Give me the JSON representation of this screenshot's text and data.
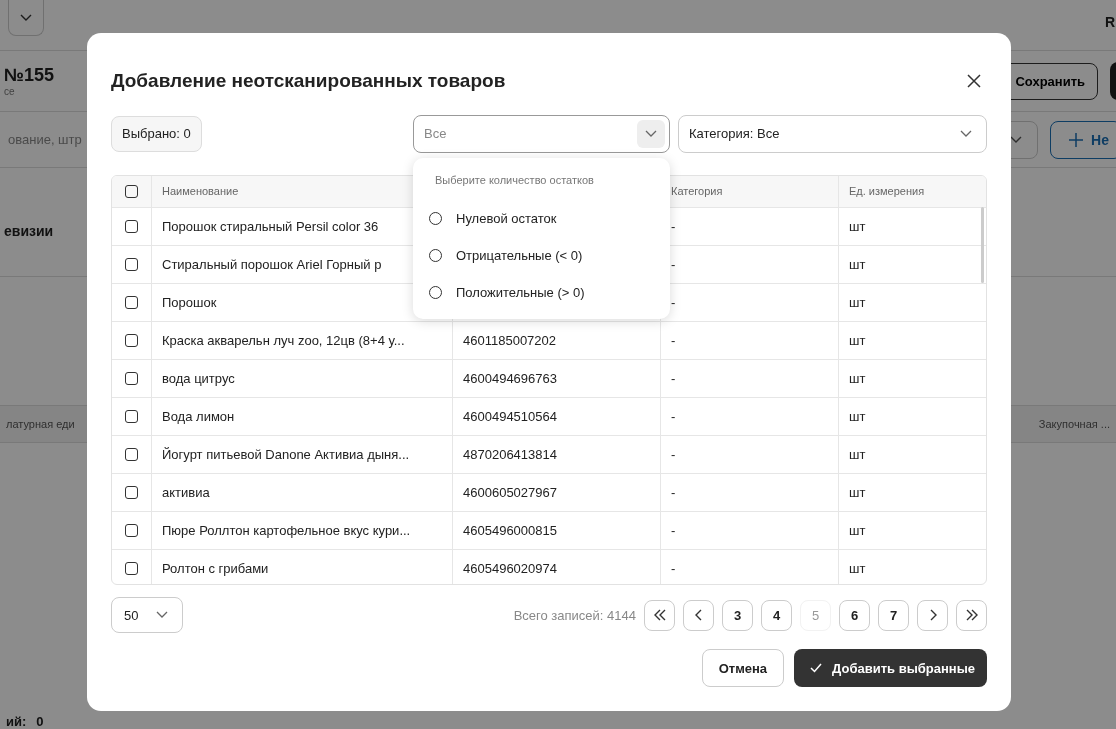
{
  "background": {
    "top_right_text": "R",
    "doc_title": "№155",
    "doc_subtitle": "се",
    "save_button": "Сохранить",
    "search_placeholder": "ование, штр",
    "add_button": "Не",
    "section_title": "евизии",
    "table_columns": [
      "латурная еди",
      "Закупочная ..."
    ],
    "footer_label": "ий:",
    "footer_value": "0"
  },
  "dialog": {
    "title": "Добавление неотсканированных товаров",
    "selected_count": "Выбрано: 0",
    "stock_filter": {
      "placeholder": "Все",
      "open": true,
      "menu_title": "Выберите количество остатков",
      "options": [
        {
          "label": "Нулевой остаток",
          "selected": false
        },
        {
          "label": "Отрицательные (< 0)",
          "selected": false
        },
        {
          "label": "Положительные (> 0)",
          "selected": false
        }
      ]
    },
    "category_filter": {
      "value": "Категория: Все"
    },
    "table": {
      "select_all_checked": false,
      "headers": {
        "name": "Наименование",
        "category": "Категория",
        "unit": "Ед. измерения"
      },
      "rows": [
        {
          "checked": false,
          "name": "Порошок стиральный Persil color 36",
          "barcode": null,
          "category": "-",
          "unit": "шт"
        },
        {
          "checked": false,
          "name": "Стиральный порошок Ariel Горный р",
          "barcode": null,
          "category": "-",
          "unit": "шт"
        },
        {
          "checked": false,
          "name": "Порошок",
          "barcode": null,
          "category": "-",
          "unit": "шт"
        },
        {
          "checked": false,
          "name": "Краска акварельн луч zoo, 12цв (8+4 у...",
          "barcode": "4601185007202",
          "category": "-",
          "unit": "шт"
        },
        {
          "checked": false,
          "name": "вода цитрус",
          "barcode": "4600494696763",
          "category": "-",
          "unit": "шт"
        },
        {
          "checked": false,
          "name": "Вода лимон",
          "barcode": "4600494510564",
          "category": "-",
          "unit": "шт"
        },
        {
          "checked": false,
          "name": "Йогурт питьевой Danone Активиа дыня...",
          "barcode": "4870206413814",
          "category": "-",
          "unit": "шт"
        },
        {
          "checked": false,
          "name": "активиа",
          "barcode": "4600605027967",
          "category": "-",
          "unit": "шт"
        },
        {
          "checked": false,
          "name": "Пюре Роллтон картофельное вкус кури...",
          "barcode": "4605496000815",
          "category": "-",
          "unit": "шт"
        },
        {
          "checked": false,
          "name": "Ролтон с грибами",
          "barcode": "4605496020974",
          "category": "-",
          "unit": "шт"
        }
      ]
    },
    "page_size": "50",
    "total": "Всего записей: 4144",
    "pages": [
      {
        "kind": "first"
      },
      {
        "kind": "prev"
      },
      {
        "kind": "number",
        "label": "3",
        "selected": false
      },
      {
        "kind": "number",
        "label": "4",
        "selected": false
      },
      {
        "kind": "number",
        "label": "5",
        "selected": true
      },
      {
        "kind": "number",
        "label": "6",
        "selected": false
      },
      {
        "kind": "number",
        "label": "7",
        "selected": false
      },
      {
        "kind": "next"
      },
      {
        "kind": "last"
      }
    ],
    "cancel_button": "Отмена",
    "confirm_button": "Добавить выбранные"
  }
}
